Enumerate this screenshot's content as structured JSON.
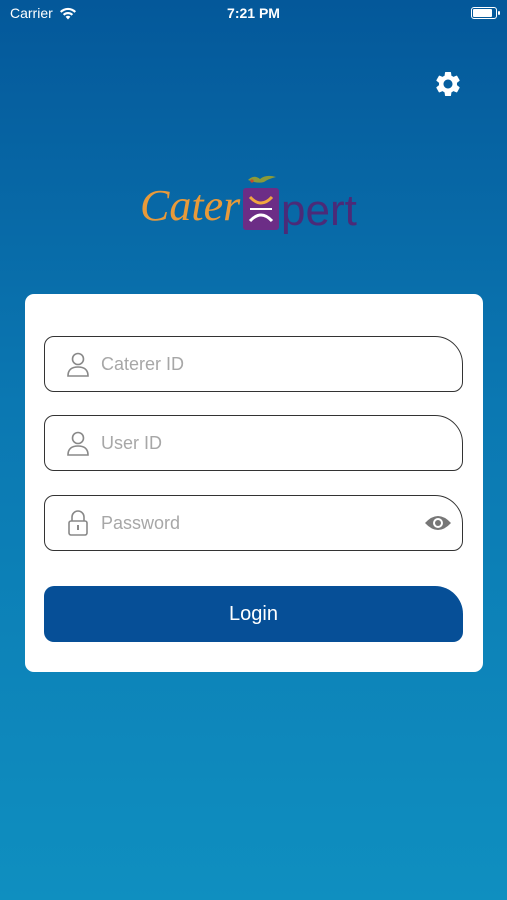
{
  "status_bar": {
    "carrier": "Carrier",
    "time": "7:21 PM"
  },
  "settings": {
    "icon": "gear-icon"
  },
  "logo": {
    "left_text": "Cater",
    "right_text": "pert",
    "mark_letter": "X"
  },
  "form": {
    "caterer_id": {
      "placeholder": "Caterer ID",
      "value": "",
      "icon": "user-icon"
    },
    "user_id": {
      "placeholder": "User ID",
      "value": "",
      "icon": "user-icon"
    },
    "password": {
      "placeholder": "Password",
      "value": "",
      "icon": "lock-icon",
      "toggle_icon": "eye-icon"
    },
    "login_label": "Login"
  },
  "colors": {
    "gradient_top": "#04589a",
    "gradient_bottom": "#0f8fc0",
    "button": "#064f97",
    "logo_orange": "#e89a3a",
    "logo_purple": "#4b2a78"
  }
}
